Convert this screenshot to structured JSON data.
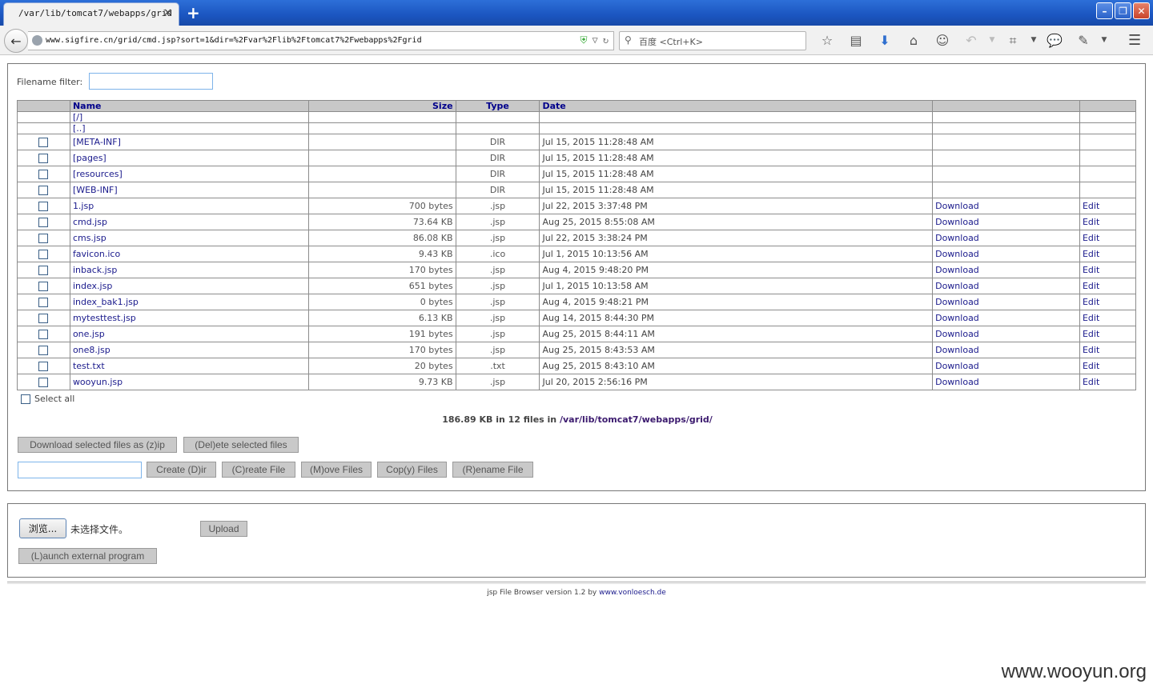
{
  "browser": {
    "tab_title": "/var/lib/tomcat7/webapps/grid",
    "url": "www.sigfire.cn/grid/cmd.jsp?sort=1&dir=%2Fvar%2Flib%2Ftomcat7%2Fwebapps%2Fgrid",
    "search_placeholder": "百度 <Ctrl+K>"
  },
  "filter": {
    "label": "Filename filter:"
  },
  "table": {
    "headers": {
      "name": "Name",
      "size": "Size",
      "type": "Type",
      "date": "Date"
    },
    "root": "[/]",
    "parent": "[..]",
    "rows": [
      {
        "name": "[META-INF]",
        "size": "",
        "type": "DIR",
        "date": "Jul 15, 2015 11:28:48 AM",
        "download": "",
        "edit": ""
      },
      {
        "name": "[pages]",
        "size": "",
        "type": "DIR",
        "date": "Jul 15, 2015 11:28:48 AM",
        "download": "",
        "edit": ""
      },
      {
        "name": "[resources]",
        "size": "",
        "type": "DIR",
        "date": "Jul 15, 2015 11:28:48 AM",
        "download": "",
        "edit": ""
      },
      {
        "name": "[WEB-INF]",
        "size": "",
        "type": "DIR",
        "date": "Jul 15, 2015 11:28:48 AM",
        "download": "",
        "edit": ""
      },
      {
        "name": "1.jsp",
        "size": "700 bytes",
        "type": ".jsp",
        "date": "Jul 22, 2015 3:37:48 PM",
        "download": "Download",
        "edit": "Edit"
      },
      {
        "name": "cmd.jsp",
        "size": "73.64 KB",
        "type": ".jsp",
        "date": "Aug 25, 2015 8:55:08 AM",
        "download": "Download",
        "edit": "Edit"
      },
      {
        "name": "cms.jsp",
        "size": "86.08 KB",
        "type": ".jsp",
        "date": "Jul 22, 2015 3:38:24 PM",
        "download": "Download",
        "edit": "Edit"
      },
      {
        "name": "favicon.ico",
        "size": "9.43 KB",
        "type": ".ico",
        "date": "Jul 1, 2015 10:13:56 AM",
        "download": "Download",
        "edit": "Edit"
      },
      {
        "name": "inback.jsp",
        "size": "170 bytes",
        "type": ".jsp",
        "date": "Aug 4, 2015 9:48:20 PM",
        "download": "Download",
        "edit": "Edit"
      },
      {
        "name": "index.jsp",
        "size": "651 bytes",
        "type": ".jsp",
        "date": "Jul 1, 2015 10:13:58 AM",
        "download": "Download",
        "edit": "Edit"
      },
      {
        "name": "index_bak1.jsp",
        "size": "0 bytes",
        "type": ".jsp",
        "date": "Aug 4, 2015 9:48:21 PM",
        "download": "Download",
        "edit": "Edit"
      },
      {
        "name": "mytesttest.jsp",
        "size": "6.13 KB",
        "type": ".jsp",
        "date": "Aug 14, 2015 8:44:30 PM",
        "download": "Download",
        "edit": "Edit"
      },
      {
        "name": "one.jsp",
        "size": "191 bytes",
        "type": ".jsp",
        "date": "Aug 25, 2015 8:44:11 AM",
        "download": "Download",
        "edit": "Edit"
      },
      {
        "name": "one8.jsp",
        "size": "170 bytes",
        "type": ".jsp",
        "date": "Aug 25, 2015 8:43:53 AM",
        "download": "Download",
        "edit": "Edit"
      },
      {
        "name": "test.txt",
        "size": "20 bytes",
        "type": ".txt",
        "date": "Aug 25, 2015 8:43:10 AM",
        "download": "Download",
        "edit": "Edit"
      },
      {
        "name": "wooyun.jsp",
        "size": "9.73 KB",
        "type": ".jsp",
        "date": "Jul 20, 2015 2:56:16 PM",
        "download": "Download",
        "edit": "Edit"
      }
    ]
  },
  "select_all": "Select all",
  "summary": {
    "text": "186.89 KB in 12 files in ",
    "path": "/var/lib/tomcat7/webapps/grid/"
  },
  "buttons": {
    "download_zip": "Download selected files as (z)ip",
    "delete": "(Del)ete selected files",
    "create_dir": "Create (D)ir",
    "create_file": "(C)reate File",
    "move": "(M)ove Files",
    "copy": "Cop(y) Files",
    "rename": "(R)ename File",
    "browse": "浏览...",
    "upload": "Upload",
    "launch": "(L)aunch external program"
  },
  "upload": {
    "no_file": "未选择文件。"
  },
  "footer": {
    "text": "jsp File Browser version 1.2 by ",
    "link": "www.vonloesch.de"
  },
  "watermark": "www.wooyun.org",
  "colors": {
    "link": "#1a1a8c",
    "header_bg": "#c8c8c8",
    "button_bg": "#c9c9c9",
    "titlebar": "#1b55c0"
  }
}
